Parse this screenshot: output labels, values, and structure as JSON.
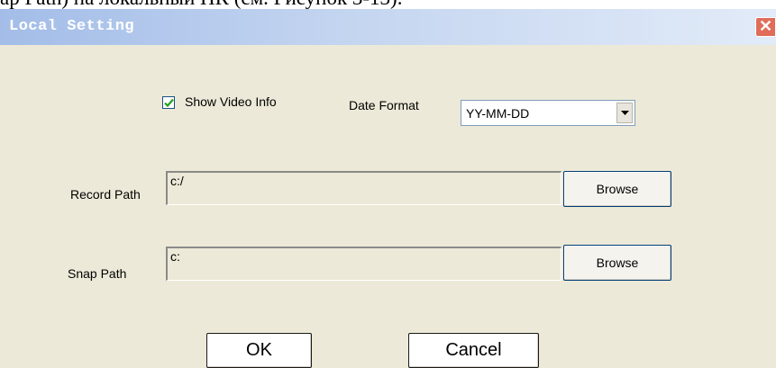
{
  "background_text": "ap Path) на локальный ПК (см. Рисунок 3-13).",
  "window": {
    "title": "Local Setting",
    "close_symbol": "✕"
  },
  "options": {
    "show_video_info": {
      "label": "Show Video Info",
      "checked": true
    },
    "date_format": {
      "label": "Date Format",
      "selected": "YY-MM-DD"
    }
  },
  "record_path": {
    "label": "Record Path",
    "value": "c:/",
    "browse_label": "Browse"
  },
  "snap_path": {
    "label": "Snap Path",
    "value": "c:",
    "browse_label": "Browse"
  },
  "footer": {
    "ok_label": "OK",
    "cancel_label": "Cancel"
  },
  "colors": {
    "dialog_bg": "#ece9d8",
    "titlebar_start": "#a3bde8",
    "titlebar_end": "#e2ebf8",
    "close_button": "#e06c5a",
    "input_border": "#7f9db9"
  },
  "icons": {
    "checkbox": "check-mark-icon",
    "dropdown": "chevron-down-icon",
    "close": "close-icon"
  }
}
